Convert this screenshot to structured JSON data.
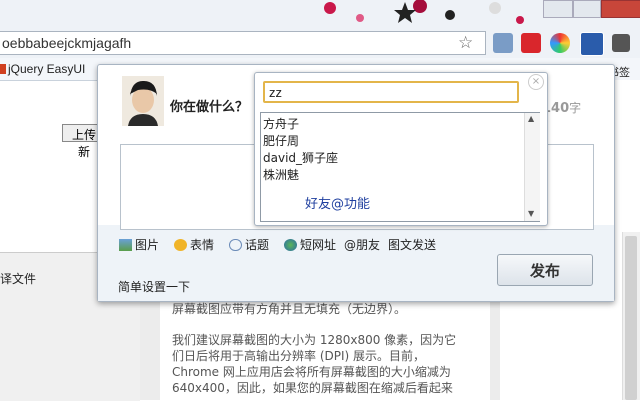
{
  "browser": {
    "url": "oebbabeejckmjagafh",
    "bookmark": "jQuery EasyUI",
    "bookmark_right": "书签"
  },
  "page": {
    "upload_button": "上传新",
    "left_label": "译文件",
    "paragraph1": "屏幕截图应带有方角并且无填充（无边界）。",
    "paragraph2_lines": [
      "我们建议屏幕截图的大小为 1280x800 像素，因为它",
      "们日后将用于高输出分辨率 (DPI) 展示。目前，",
      "Chrome 网上应用店会将所有屏幕截图的大小缩减为",
      "640x400，因此，如果您的屏幕截图在缩减后看起来"
    ]
  },
  "composer": {
    "prompt": "你在做什么？",
    "char_count": "140",
    "char_unit": "字",
    "toolbar": {
      "picture": "图片",
      "emotion": "表情",
      "topic": "话题",
      "short_url": "短网址",
      "friend": "@朋友",
      "image_send": "图文发送"
    },
    "settings_link": "简单设置一下",
    "publish_button": "发布"
  },
  "mention": {
    "input_value": "zz",
    "close_symbol": "×",
    "friends": [
      "方舟子",
      "肥仔周",
      "david_狮子座",
      "株洲魅"
    ],
    "hint": "好友@功能"
  },
  "colors": {
    "accent_border": "#e3b54a",
    "hint_blue": "#1f3f9f"
  }
}
